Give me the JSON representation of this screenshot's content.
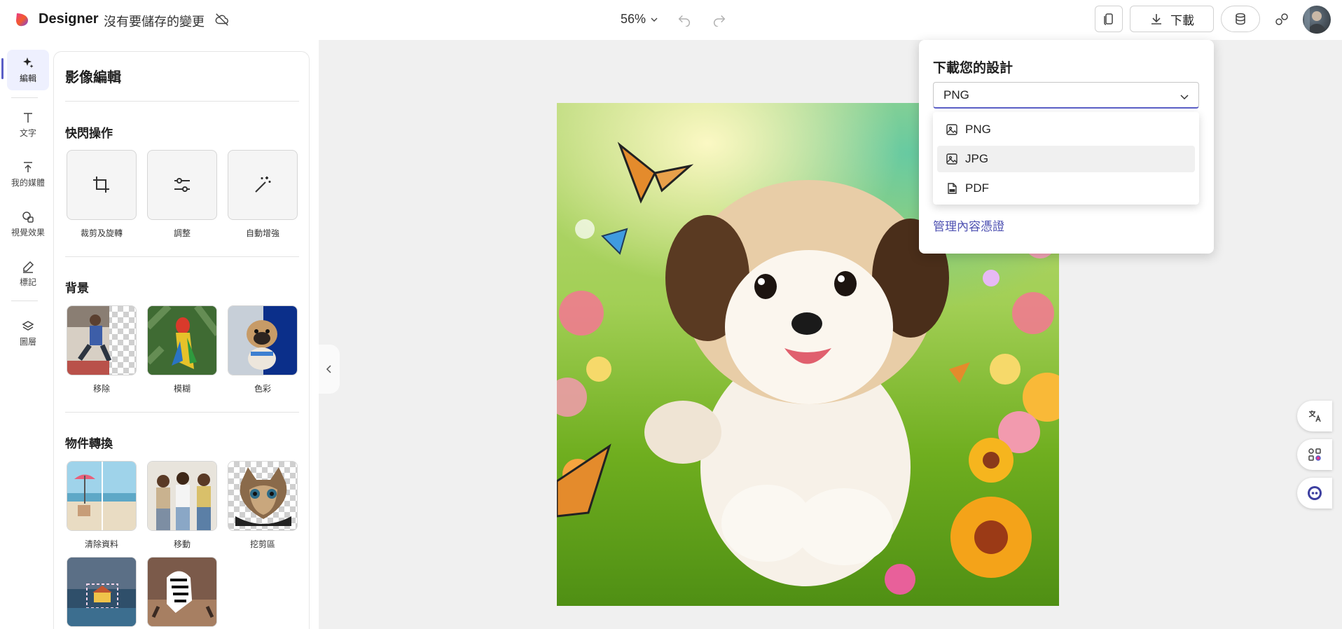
{
  "topbar": {
    "app_name": "Designer",
    "save_status": "沒有要儲存的變更",
    "zoom": "56%",
    "download_label": "下載"
  },
  "rail": {
    "items": [
      {
        "label": "編輯",
        "icon": "sparkle-icon"
      },
      {
        "label": "文字",
        "icon": "text-icon"
      },
      {
        "label": "我的媒體",
        "icon": "upload-icon"
      },
      {
        "label": "視覺效果",
        "icon": "shapes-icon"
      },
      {
        "label": "標記",
        "icon": "pen-icon"
      },
      {
        "label": "圖層",
        "icon": "layers-icon"
      }
    ]
  },
  "panel": {
    "title": "影像編輯",
    "quick_actions": {
      "heading": "快閃操作",
      "items": [
        {
          "label": "裁剪及旋轉",
          "icon": "crop-icon"
        },
        {
          "label": "調整",
          "icon": "sliders-icon"
        },
        {
          "label": "自動增強",
          "icon": "magic-wand-icon"
        }
      ]
    },
    "background": {
      "heading": "背景",
      "items": [
        {
          "label": "移除"
        },
        {
          "label": "模糊"
        },
        {
          "label": "色彩"
        }
      ]
    },
    "object_transform": {
      "heading": "物件轉換",
      "items": [
        {
          "label": "清除資料"
        },
        {
          "label": "移動"
        },
        {
          "label": "挖剪區"
        }
      ]
    }
  },
  "popover": {
    "title": "下載您的設計",
    "selected_format": "PNG",
    "options": [
      "PNG",
      "JPG",
      "PDF"
    ],
    "manage_link": "管理內容憑證"
  },
  "colors": {
    "accent": "#5b5fc7",
    "link": "#4f52b2",
    "canvas_bg": "#f0f0f0"
  }
}
